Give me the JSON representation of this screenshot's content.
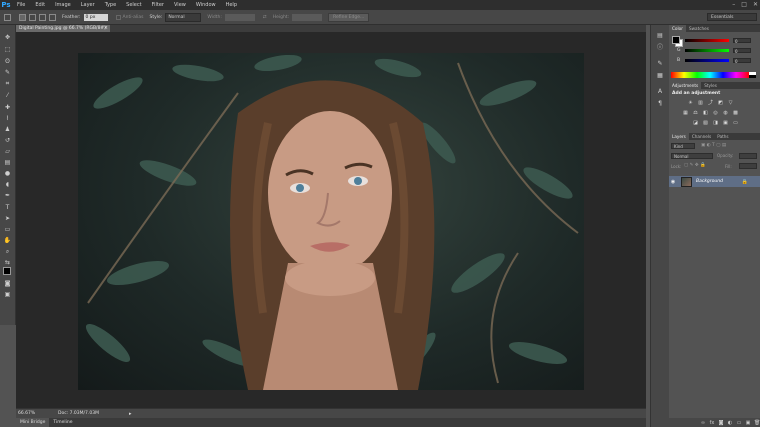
{
  "app": {
    "logo": "Ps",
    "window_controls": [
      "–",
      "□",
      "✕"
    ]
  },
  "menu": [
    "File",
    "Edit",
    "Image",
    "Layer",
    "Type",
    "Select",
    "Filter",
    "View",
    "Window",
    "Help"
  ],
  "options_bar": {
    "feather_label": "Feather:",
    "feather_value": "0 px",
    "anti_alias_label": "Anti-alias",
    "style_label": "Style:",
    "style_value": "Normal",
    "width_label": "Width:",
    "height_label": "Height:",
    "refine_edge_label": "Refine Edge...",
    "workspace": "Essentials"
  },
  "document": {
    "tab_title": "Digital Painting.jpg @ 66.7% (RGB/8#)",
    "close": "×"
  },
  "status_bar": {
    "zoom": "66.67%",
    "doc_info": "Doc: 7.03M/7.03M"
  },
  "bottom_tabs": [
    "Mini Bridge",
    "Timeline"
  ],
  "color_panel": {
    "tabs": [
      "Color",
      "Swatches"
    ],
    "r_label": "R",
    "g_label": "G",
    "b_label": "B",
    "r": "0",
    "g": "0",
    "b": "0"
  },
  "adjustments_panel": {
    "tabs": [
      "Adjustments",
      "Styles"
    ],
    "title": "Add an adjustment"
  },
  "layers_panel": {
    "tabs": [
      "Layers",
      "Channels",
      "Paths"
    ],
    "kind": "Kind",
    "blend_mode": "Normal",
    "opacity_label": "Opacity:",
    "lock_label": "Lock:",
    "fill_label": "Fill:",
    "layer_name": "Background"
  },
  "colors": {
    "accent": "#31a8ff",
    "selected_layer": "#5f6e86"
  }
}
